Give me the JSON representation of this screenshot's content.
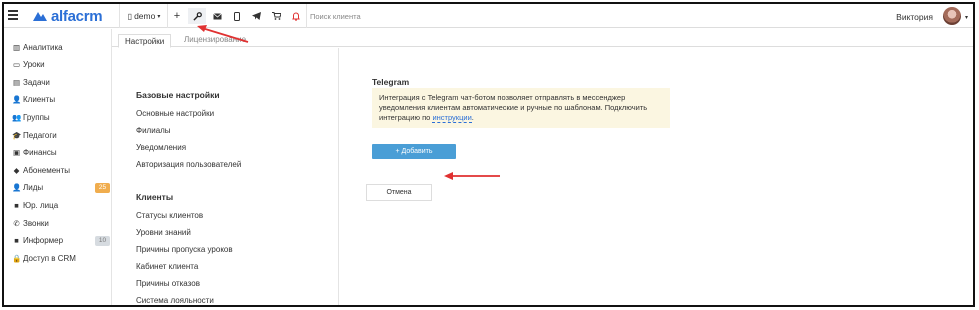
{
  "brand": {
    "name": "alfacrm"
  },
  "topbar": {
    "branch": "demo",
    "search_placeholder": "Поиск клиента",
    "user_name": "Виктория",
    "buttons": [
      {
        "icon": "plus-icon",
        "glyph": "+"
      },
      {
        "icon": "wrench-icon",
        "glyph": "🔧"
      },
      {
        "icon": "mail-icon",
        "glyph": "✉"
      },
      {
        "icon": "phone-icon",
        "glyph": "▯"
      },
      {
        "icon": "telegram-icon",
        "glyph": "➤"
      },
      {
        "icon": "cart-icon",
        "glyph": "🛒"
      },
      {
        "icon": "bell-icon",
        "glyph": "🔔"
      }
    ]
  },
  "sidebar": {
    "items": [
      {
        "label": "Аналитика",
        "icon": "chart-icon",
        "glyph": "▥"
      },
      {
        "label": "Уроки",
        "icon": "calendar-icon",
        "glyph": "▭"
      },
      {
        "label": "Задачи",
        "icon": "tasks-icon",
        "glyph": "▤"
      },
      {
        "label": "Клиенты",
        "icon": "user-icon",
        "glyph": "👤"
      },
      {
        "label": "Группы",
        "icon": "users-icon",
        "glyph": "👥"
      },
      {
        "label": "Педагоги",
        "icon": "graduation-cap-icon",
        "glyph": "🎓"
      },
      {
        "label": "Финансы",
        "icon": "money-icon",
        "glyph": "▣"
      },
      {
        "label": "Абонементы",
        "icon": "tag-icon",
        "glyph": "◆"
      },
      {
        "label": "Лиды",
        "icon": "user-plus-icon",
        "glyph": "👤",
        "badge": "25",
        "badge_color": "#f0ad4e"
      },
      {
        "label": "Юр. лица",
        "icon": "briefcase-icon",
        "glyph": "■"
      },
      {
        "label": "Звонки",
        "icon": "phone-call-icon",
        "glyph": "✆"
      },
      {
        "label": "Информер",
        "icon": "informer-icon",
        "glyph": "■",
        "badge": "10",
        "badge_color": "#d6dbe0",
        "badge_text_color": "#777"
      },
      {
        "label": "Доступ в CRM",
        "icon": "lock-icon",
        "glyph": "🔒"
      }
    ]
  },
  "tabs": [
    {
      "label": "Настройки",
      "active": true
    },
    {
      "label": "Лицензирование",
      "active": false
    }
  ],
  "settings": {
    "basic_title": "Базовые настройки",
    "basic_links": [
      "Основные настройки",
      "Филиалы",
      "Уведомления",
      "Авторизация пользователей"
    ],
    "clients_title": "Клиенты",
    "clients_links": [
      "Статусы клиентов",
      "Уровни знаний",
      "Причины пропуска уроков",
      "Кабинет клиента",
      "Причины отказов",
      "Система лояльности"
    ]
  },
  "telegram": {
    "title": "Telegram",
    "info_text": "Интеграция с Telegram чат-ботом позволяет отправлять в мессенджер уведомления клиентам автоматические и ручные по шаблонам. Подключить интеграцию по ",
    "info_link": "инструкции",
    "info_end": ".",
    "add_button": "+ Добавить",
    "cancel_button": "Отмена"
  },
  "colors": {
    "brand": "#2b6fd6",
    "primary_button": "#4a9ed6",
    "info_bg": "#fbf6e1",
    "annotation_arrow": "#e03131"
  }
}
